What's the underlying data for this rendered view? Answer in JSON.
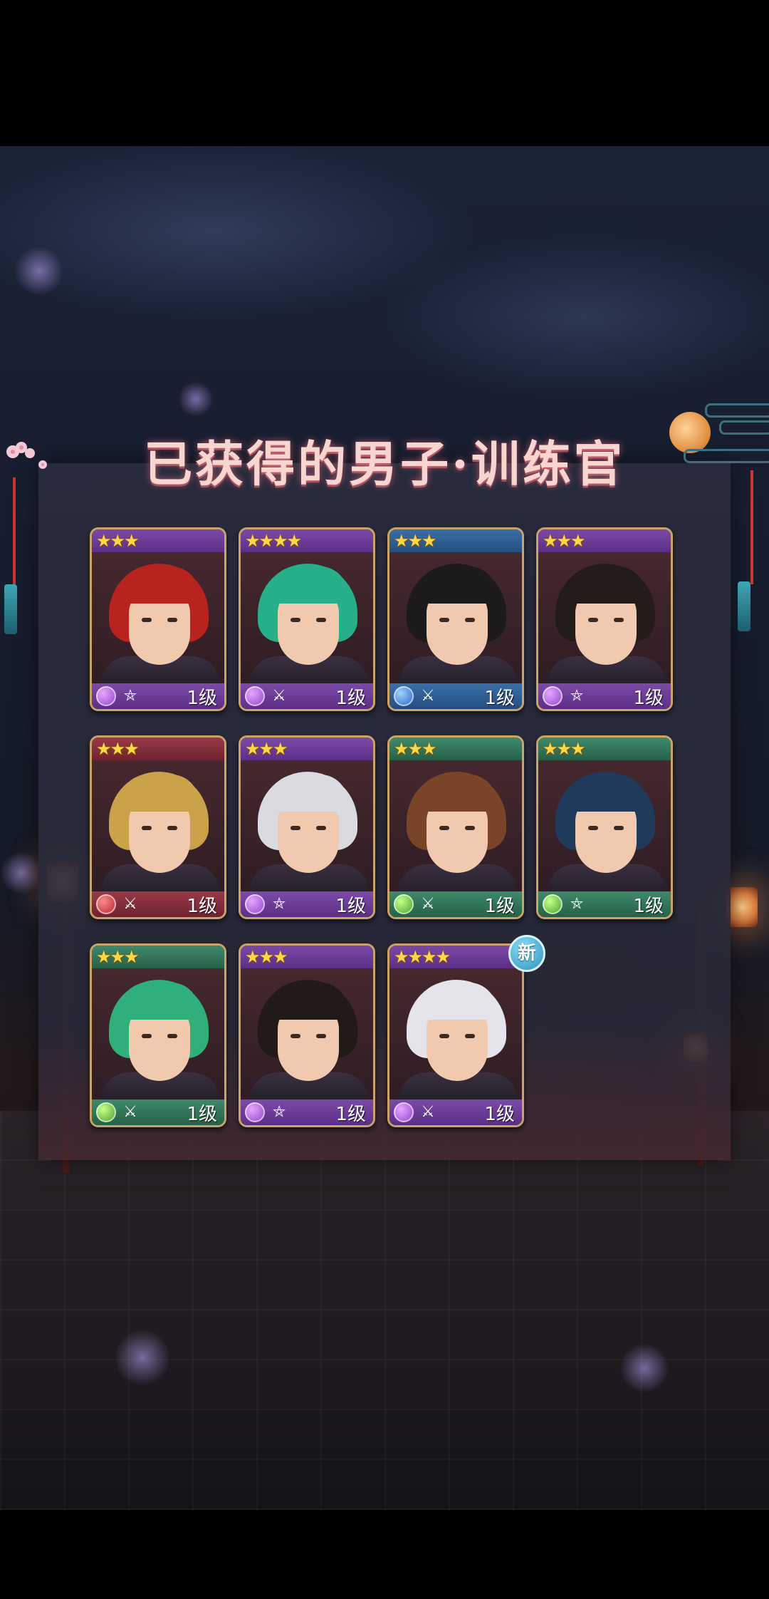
{
  "title": "已获得的男子·训练官",
  "cards": [
    {
      "stars": "★★★",
      "element": "purple",
      "weapon": "⛤",
      "level": "1级",
      "hair": "#b8231f",
      "frame": "purple"
    },
    {
      "stars": "★★★★",
      "element": "purple",
      "weapon": "⚔",
      "level": "1级",
      "hair": "#26b08a",
      "frame": "purple"
    },
    {
      "stars": "★★★",
      "element": "blue",
      "weapon": "⚔",
      "level": "1级",
      "hair": "#1c1a1c",
      "frame": "blue"
    },
    {
      "stars": "★★★",
      "element": "purple",
      "weapon": "⛤",
      "level": "1级",
      "hair": "#231c18",
      "frame": "purple"
    },
    {
      "stars": "★★★",
      "element": "red",
      "weapon": "⚔",
      "level": "1级",
      "hair": "#c9a24a",
      "frame": "red"
    },
    {
      "stars": "★★★",
      "element": "purple",
      "weapon": "⛤",
      "level": "1级",
      "hair": "#d9dbe0",
      "frame": "purple"
    },
    {
      "stars": "★★★",
      "element": "green",
      "weapon": "⚔",
      "level": "1级",
      "hair": "#7a4428",
      "frame": "green"
    },
    {
      "stars": "★★★",
      "element": "green",
      "weapon": "⛤",
      "level": "1级",
      "hair": "#1f3a5a",
      "frame": "green"
    },
    {
      "stars": "★★★",
      "element": "green",
      "weapon": "⚔",
      "level": "1级",
      "hair": "#2fb07a",
      "frame": "green"
    },
    {
      "stars": "★★★",
      "element": "purple",
      "weapon": "⛤",
      "level": "1级",
      "hair": "#221a16",
      "frame": "purple"
    },
    {
      "stars": "★★★★",
      "element": "purple",
      "weapon": "⚔",
      "level": "1级",
      "hair": "#e4e4ea",
      "frame": "purple",
      "badge": "新"
    }
  ]
}
